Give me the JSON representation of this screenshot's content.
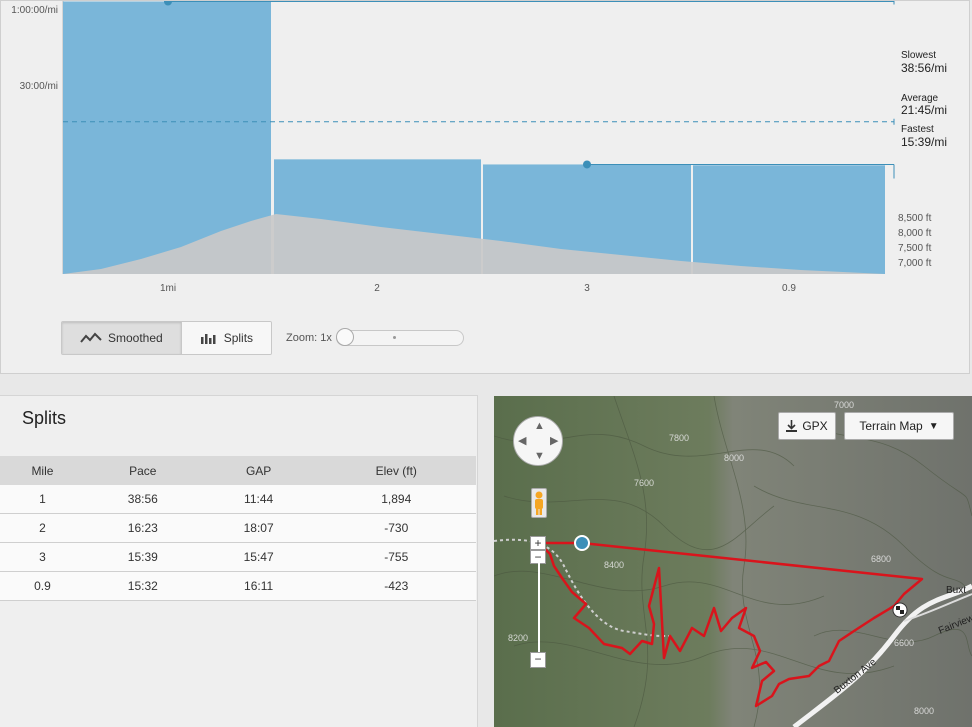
{
  "colors": {
    "bar": "#7ab6d9",
    "line": "#3c8fb8",
    "elevation": "#c9c9c9",
    "route": "#d9141c"
  },
  "chart_data": {
    "type": "bar",
    "categories": [
      "1",
      "2",
      "3",
      "0.9"
    ],
    "x_tick_labels": [
      "1mi",
      "2",
      "3",
      "0.9"
    ],
    "pace_minutes": [
      38.93,
      16.38,
      15.65,
      15.53
    ],
    "y_tick_labels": [
      "1:00:00/mi",
      "30:00/mi"
    ],
    "ylim_minutes": [
      0,
      60
    ],
    "elevation_axis_labels": [
      "8,500 ft",
      "8,000 ft",
      "7,500 ft",
      "7,000 ft"
    ],
    "markers": [
      {
        "label": "Slowest",
        "value": "38:56/mi",
        "minutes": 38.93
      },
      {
        "label": "Average",
        "value": "21:45/mi",
        "minutes": 21.75
      },
      {
        "label": "Fastest",
        "value": "15:39/mi",
        "minutes": 15.65
      }
    ]
  },
  "controls": {
    "smoothed": "Smoothed",
    "splits": "Splits",
    "zoom": "Zoom: 1x"
  },
  "splits": {
    "title": "Splits",
    "headers": [
      "Mile",
      "Pace",
      "GAP",
      "Elev (ft)"
    ],
    "rows": [
      [
        "1",
        "38:56",
        "11:44",
        "1,894"
      ],
      [
        "2",
        "16:23",
        "18:07",
        "-730"
      ],
      [
        "3",
        "15:39",
        "15:47",
        "-755"
      ],
      [
        "0.9",
        "15:32",
        "16:11",
        "-423"
      ]
    ]
  },
  "map": {
    "gpx": "GPX",
    "terrain": "Terrain Map",
    "zoom_in": "+",
    "zoom_out": "−",
    "labels": [
      "7800",
      "8000",
      "7600",
      "8200",
      "8400",
      "6800",
      "7000",
      "8000",
      "6600",
      "Buxton Ave",
      "Fairview",
      "Buxt"
    ]
  }
}
